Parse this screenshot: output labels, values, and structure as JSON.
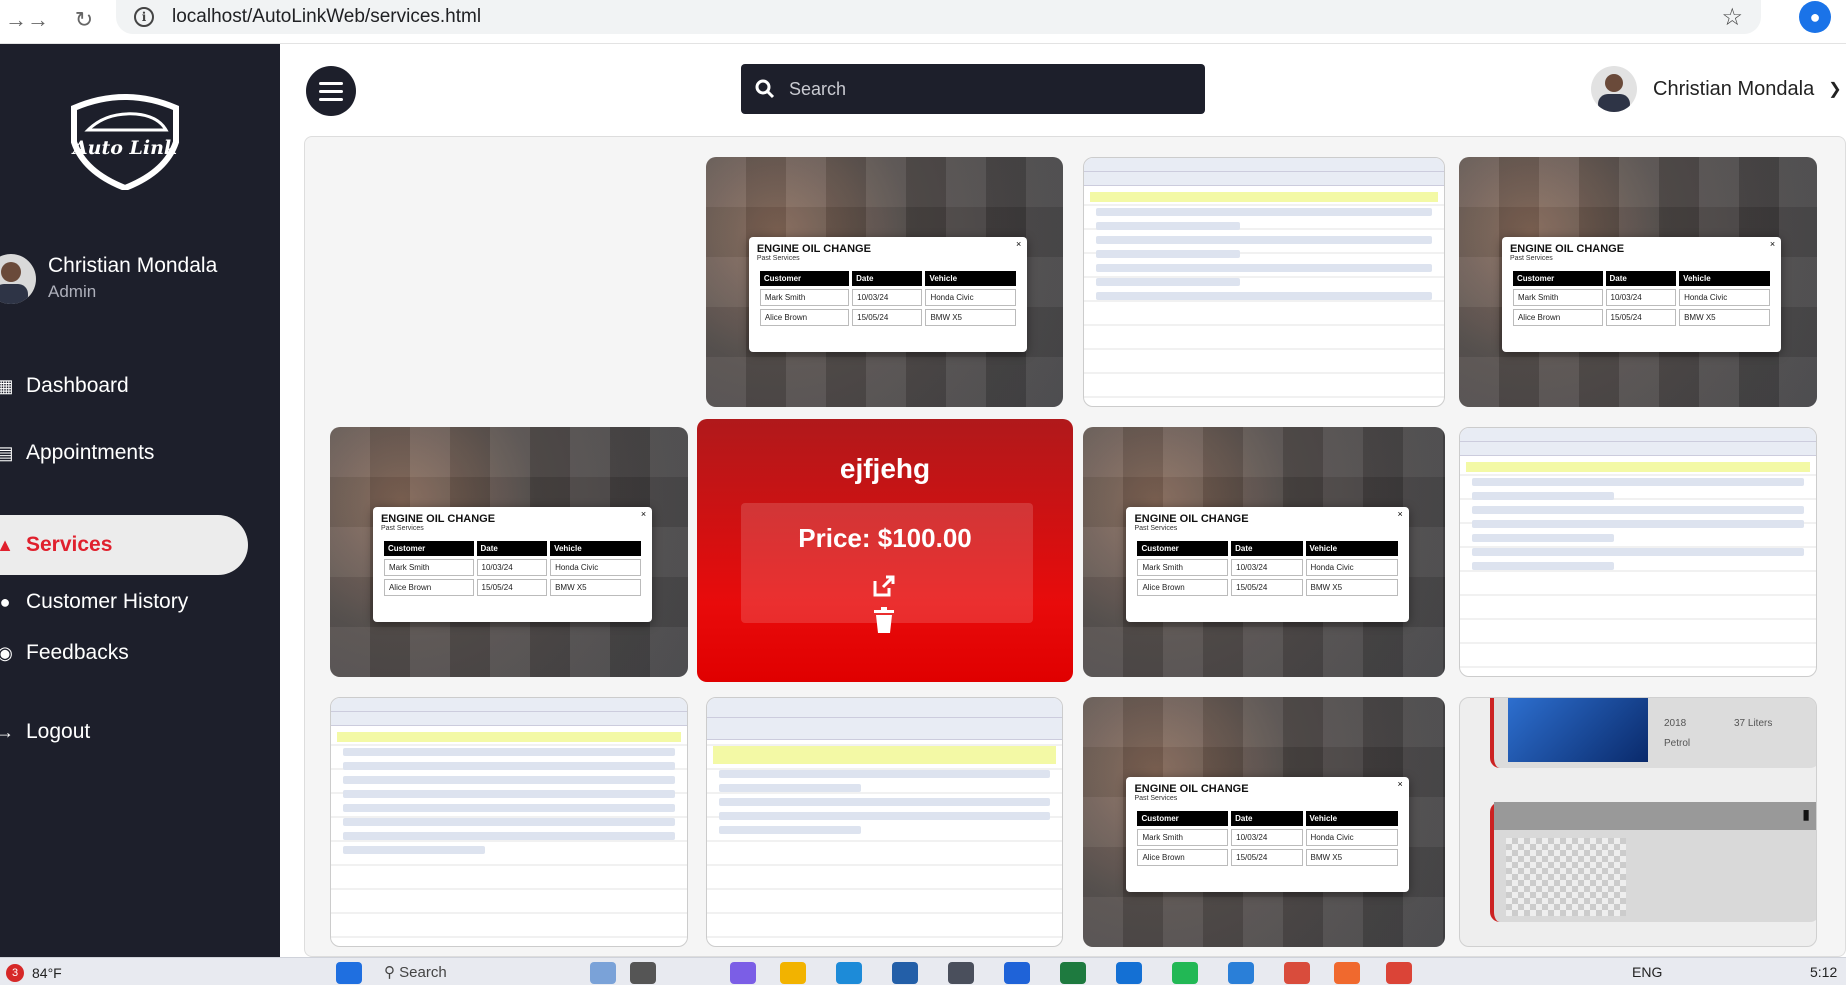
{
  "browser": {
    "url": "localhost/AutoLinkWeb/services.html"
  },
  "sidebar": {
    "logo_text": "Auto Link",
    "user": {
      "name": "Christian Mondala",
      "role": "Admin"
    },
    "items": [
      {
        "label": "Dashboard",
        "icon": "dashboard-icon",
        "active": false
      },
      {
        "label": "Appointments",
        "icon": "calendar-icon",
        "active": false
      },
      {
        "label": "Services",
        "icon": "car-icon",
        "active": true
      },
      {
        "label": "Customer History",
        "icon": "user-history-icon",
        "active": false
      },
      {
        "label": "Feedbacks",
        "icon": "comments-icon",
        "active": false
      },
      {
        "label": "Logout",
        "icon": "logout-icon",
        "active": false
      }
    ]
  },
  "topbar": {
    "search_placeholder": "Search",
    "user_name": "Christian Mondala"
  },
  "oil_modal": {
    "title": "ENGINE OIL CHANGE",
    "subtitle": "Past Services",
    "headers": [
      "Customer",
      "Date",
      "Vehicle"
    ],
    "rows": [
      [
        "Mark Smith",
        "10/03/24",
        "Honda Civic"
      ],
      [
        "Alice Brown",
        "15/05/24",
        "BMW X5"
      ]
    ]
  },
  "hover_card": {
    "title": "ejfjehg",
    "price": "Price: $100.00"
  },
  "car_card": {
    "year": "2018",
    "capacity": "37 Liters",
    "fuel": "Petrol"
  },
  "taskbar": {
    "notification_count": "3",
    "temperature": "84°F",
    "search_label": "Search",
    "language": "ENG",
    "time": "5:12"
  },
  "colors": {
    "sidebar_bg": "#1d1f2b",
    "accent": "#e0202d",
    "hover_red": "#e80b0b"
  }
}
